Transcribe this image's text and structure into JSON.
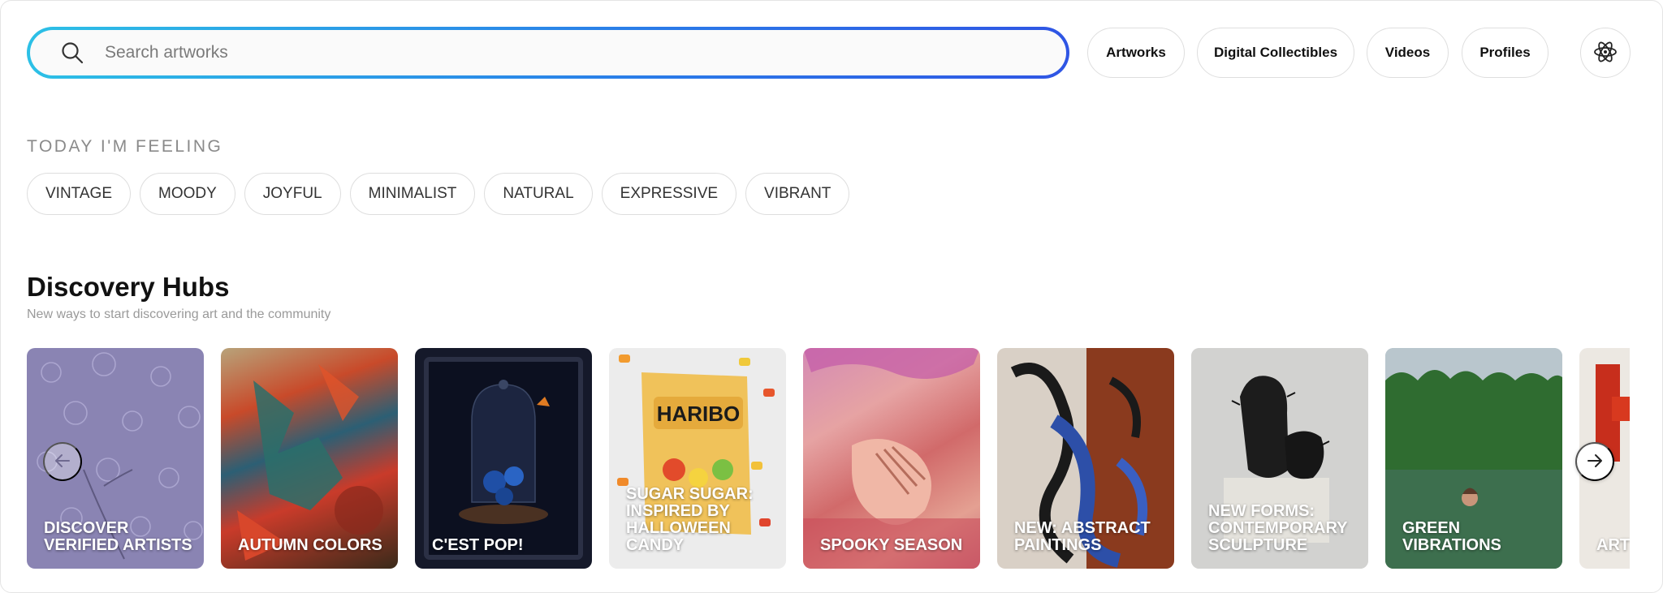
{
  "search": {
    "placeholder": "Search artworks",
    "value": ""
  },
  "filters": [
    {
      "label": "Artworks"
    },
    {
      "label": "Digital Collectibles"
    },
    {
      "label": "Videos"
    },
    {
      "label": "Profiles"
    }
  ],
  "extra_button_icon": "atom-icon",
  "mood": {
    "title": "TODAY I'M FEELING",
    "chips": [
      "VINTAGE",
      "MOODY",
      "JOYFUL",
      "MINIMALIST",
      "NATURAL",
      "EXPRESSIVE",
      "VIBRANT"
    ]
  },
  "hubs": {
    "title": "Discovery Hubs",
    "subtitle": "New ways to start discovering art and the community",
    "cards": [
      {
        "label": "DISCOVER VERIFIED ARTISTS"
      },
      {
        "label": "AUTUMN COLORS"
      },
      {
        "label": "C'EST POP!"
      },
      {
        "label": "SUGAR SUGAR: INSPIRED BY HALLOWEEN CANDY"
      },
      {
        "label": "SPOOKY SEASON"
      },
      {
        "label": "NEW: ABSTRACT PAINTINGS"
      },
      {
        "label": "NEW FORMS: CONTEMPORARY SCULPTURE"
      },
      {
        "label": "GREEN VIBRATIONS"
      },
      {
        "label": "ART WAT LOFT"
      }
    ],
    "prev_icon": "arrow-left-icon",
    "next_icon": "arrow-right-icon"
  },
  "colors": {
    "search_gradient_start": "#2cc0e6",
    "search_gradient_end": "#2f55e4"
  }
}
